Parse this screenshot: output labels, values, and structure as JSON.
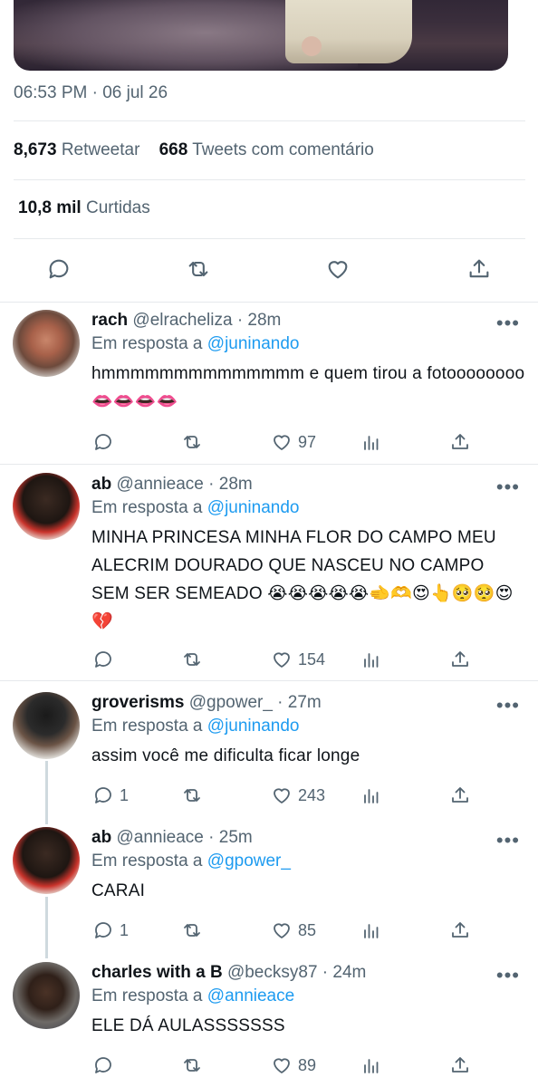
{
  "tweet": {
    "timestamp": "06:53 PM · 06 jul 26",
    "retweets_count": "8,673",
    "retweets_label": "Retweetar",
    "quotes_count": "668",
    "quotes_label": "Tweets com comentário",
    "likes_count": "10,8 mil",
    "likes_label": "Curtidas"
  },
  "replies": [
    {
      "name": "rach",
      "meta": "@elracheliza · 28m",
      "reply_prefix": "Em resposta a",
      "reply_to": "@juninando",
      "text": "hmmmmmmmmmmmmmm e quem tirou a fotoooooooo 👄👄👄👄",
      "replies": "",
      "likes": "97"
    },
    {
      "name": "ab",
      "meta": "@annieace · 28m",
      "reply_prefix": "Em resposta a",
      "reply_to": "@juninando",
      "text": "MINHA PRINCESA MINHA FLOR DO CAMPO MEU ALECRIM DOURADO QUE NASCEU NO CAMPO SEM SER SEMEADO 😭😭😭😭😭🫲🫶😍👆🥺🥺😍💔",
      "replies": "",
      "likes": "154"
    },
    {
      "name": "groverisms",
      "meta": "@gpower_ · 27m",
      "reply_prefix": "Em resposta a",
      "reply_to": "@juninando",
      "text": "assim você me dificulta ficar longe",
      "replies": "1",
      "likes": "243"
    },
    {
      "name": "ab",
      "meta": "@annieace · 25m",
      "reply_prefix": "Em resposta a",
      "reply_to": "@gpower_",
      "text": "CARAI",
      "replies": "1",
      "likes": "85"
    },
    {
      "name": "charles with a B",
      "meta": "@becksy87 · 24m",
      "reply_prefix": "Em resposta a",
      "reply_to": "@annieace",
      "text": "ELE DÁ AULASSSSSSS",
      "replies": "",
      "likes": "89"
    }
  ],
  "more_glyph": "•••",
  "colors": {
    "link": "#1d9bf0",
    "muted": "#536471",
    "text": "#0f1419",
    "divider": "#e6e9ec"
  }
}
